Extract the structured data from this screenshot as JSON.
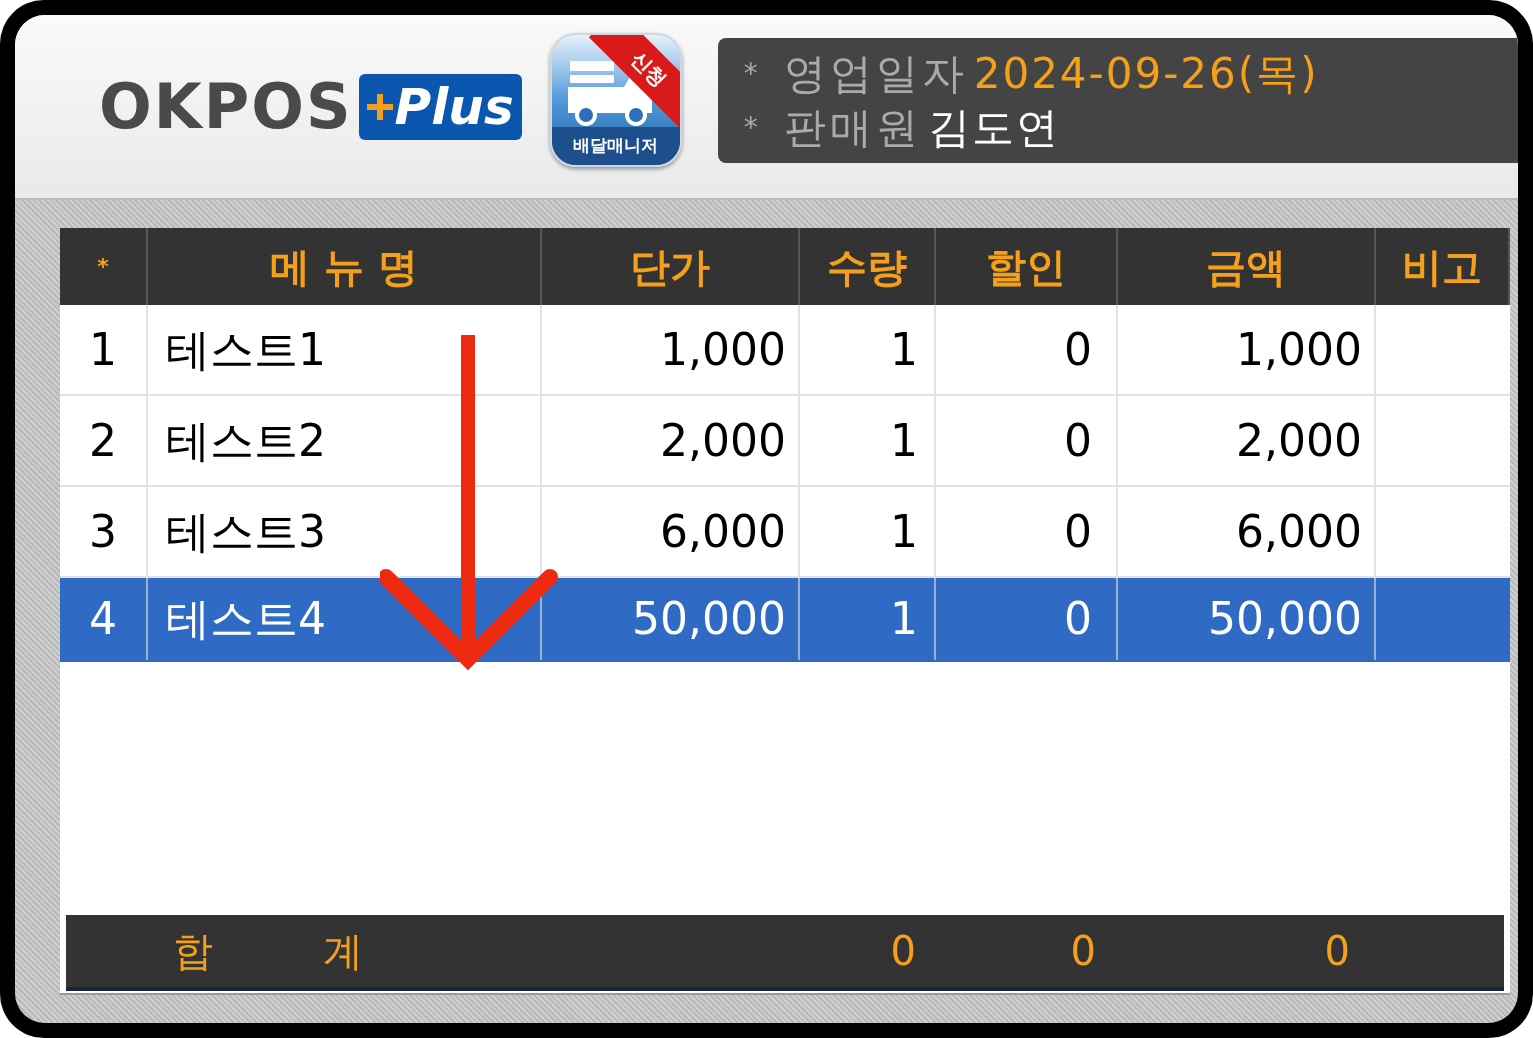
{
  "header": {
    "logo": {
      "text": "OKPOS",
      "badge": "Plus"
    },
    "app_icon": {
      "ribbon": "신청",
      "label": "배달매니저"
    },
    "info": [
      {
        "kind": "date",
        "bullet": "*",
        "label": "영업일자",
        "value": "2024-09-26(목)"
      },
      {
        "kind": "name",
        "bullet": "*",
        "label": "판매원",
        "value": "김도연"
      }
    ]
  },
  "table": {
    "columns": [
      "*",
      "메 뉴 명",
      "단가",
      "수량",
      "할인",
      "금액",
      "비고"
    ],
    "rows": [
      {
        "cells": [
          "1",
          "테스트1",
          "1,000",
          "1",
          "0",
          "1,000",
          ""
        ],
        "selected": false
      },
      {
        "cells": [
          "2",
          "테스트2",
          "2,000",
          "1",
          "0",
          "2,000",
          ""
        ],
        "selected": false
      },
      {
        "cells": [
          "3",
          "테스트3",
          "6,000",
          "1",
          "0",
          "6,000",
          ""
        ],
        "selected": false
      },
      {
        "cells": [
          "4",
          "테스트4",
          "50,000",
          "1",
          "0",
          "50,000",
          ""
        ],
        "selected": true
      }
    ]
  },
  "total": {
    "labels": [
      "합",
      "계"
    ],
    "quantity": "0",
    "discount": "0",
    "amount": "0"
  }
}
